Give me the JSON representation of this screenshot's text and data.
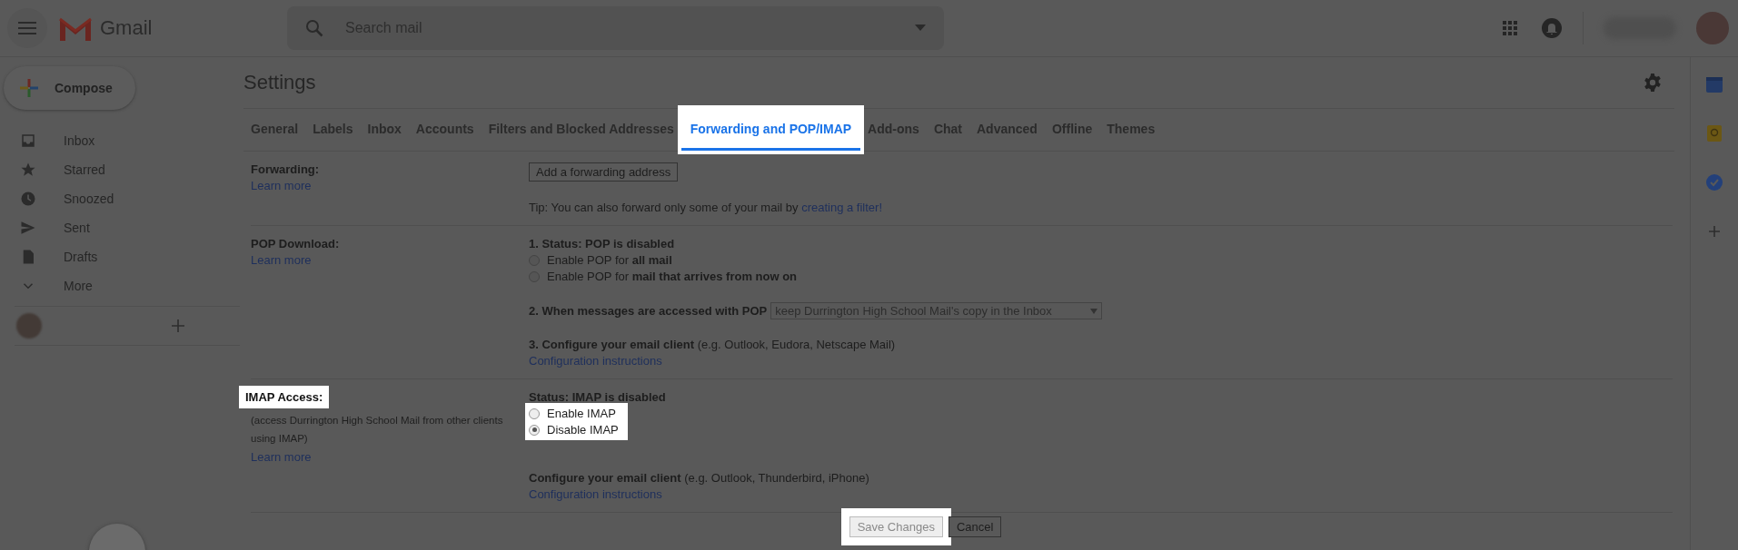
{
  "header": {
    "app_name": "Gmail",
    "search": {
      "placeholder": "Search mail"
    }
  },
  "compose": {
    "label": "Compose"
  },
  "sidebar": {
    "items": [
      {
        "label": "Inbox",
        "kind": "inbox"
      },
      {
        "label": "Starred",
        "kind": "star"
      },
      {
        "label": "Snoozed",
        "kind": "clock"
      },
      {
        "label": "Sent",
        "kind": "send"
      },
      {
        "label": "Drafts",
        "kind": "draft"
      },
      {
        "label": "More",
        "kind": "more"
      }
    ]
  },
  "settings": {
    "title": "Settings",
    "tabs": [
      {
        "label": "General",
        "selected": false,
        "highlighted": false
      },
      {
        "label": "Labels",
        "selected": false,
        "highlighted": false
      },
      {
        "label": "Inbox",
        "selected": false,
        "highlighted": false
      },
      {
        "label": "Accounts",
        "selected": false,
        "highlighted": false
      },
      {
        "label": "Filters and Blocked Addresses",
        "selected": false,
        "highlighted": false
      },
      {
        "label": "Forwarding and POP/IMAP",
        "selected": true,
        "highlighted": true
      },
      {
        "label": "Add-ons",
        "selected": false,
        "highlighted": false
      },
      {
        "label": "Chat",
        "selected": false,
        "highlighted": false
      },
      {
        "label": "Advanced",
        "selected": false,
        "highlighted": false
      },
      {
        "label": "Offline",
        "selected": false,
        "highlighted": false
      },
      {
        "label": "Themes",
        "selected": false,
        "highlighted": false
      }
    ],
    "forwarding": {
      "label": "Forwarding:",
      "link": "Learn more",
      "button": "Add a forwarding address",
      "tip": "Tip: You can also forward only some of your mail by ",
      "tip_link": "creating a filter!"
    },
    "pop": {
      "label": "POP Download:",
      "link": "Learn more",
      "status": "1. Status: POP is disabled",
      "options": [
        {
          "text": "Enable POP for **all mail**",
          "selected": false
        },
        {
          "text": "Enable POP for **mail that arrives from now on**",
          "selected": false
        }
      ],
      "when_label": "2. When messages are accessed with POP",
      "when_select": {
        "value": "keep Durrington High School Mail's copy in the Inbox"
      },
      "configure": "**3. Configure your email client** (e.g. Outlook, Eudora, Netscape Mail)",
      "configure_link": "Configuration instructions"
    },
    "imap": {
      "label": "IMAP Access:",
      "label_highlighted": true,
      "description": "(access Durrington High School Mail from other clients using IMAP)",
      "link": "Learn more",
      "status": "Status: IMAP is disabled",
      "options": [
        {
          "text": "Enable IMAP",
          "selected": false
        },
        {
          "text": "Disable IMAP",
          "selected": true
        }
      ],
      "options_highlighted": true,
      "configure": "**Configure your email client** (e.g. Outlook, Thunderbird, iPhone)",
      "configure_link": "Configuration instructions"
    },
    "actions": [
      {
        "label": "Save Changes",
        "disabled": true,
        "highlighted": true
      },
      {
        "label": "Cancel",
        "disabled": false,
        "highlighted": false
      }
    ]
  }
}
